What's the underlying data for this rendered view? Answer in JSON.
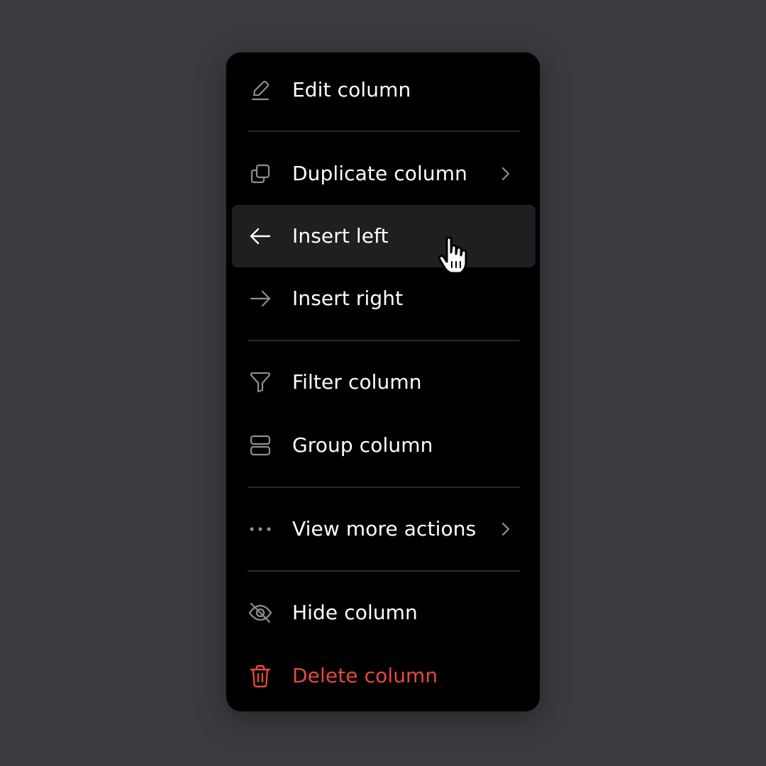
{
  "menu": {
    "items": [
      {
        "id": "edit",
        "label": "Edit column",
        "icon": "pencil-icon"
      },
      {
        "id": "duplicate",
        "label": "Duplicate column",
        "icon": "copy-icon",
        "has_submenu": true
      },
      {
        "id": "insert-left",
        "label": "Insert left",
        "icon": "arrow-left-icon",
        "hovered": true
      },
      {
        "id": "insert-right",
        "label": "Insert right",
        "icon": "arrow-right-icon"
      },
      {
        "id": "filter",
        "label": "Filter column",
        "icon": "filter-icon"
      },
      {
        "id": "group",
        "label": "Group column",
        "icon": "group-icon"
      },
      {
        "id": "more",
        "label": "View more actions",
        "icon": "more-horizontal-icon",
        "has_submenu": true
      },
      {
        "id": "hide",
        "label": "Hide column",
        "icon": "eye-off-icon"
      },
      {
        "id": "delete",
        "label": "Delete column",
        "icon": "trash-icon",
        "destructive": true
      }
    ]
  },
  "colors": {
    "background": "#3a3b40",
    "menu_background": "#000000",
    "hover_background": "#1f1f21",
    "text": "#ffffff",
    "icon": "#8e8e93",
    "danger": "#e5493a",
    "divider": "#2a2a2c"
  },
  "cursor": {
    "icon": "hand-pointer-icon"
  }
}
